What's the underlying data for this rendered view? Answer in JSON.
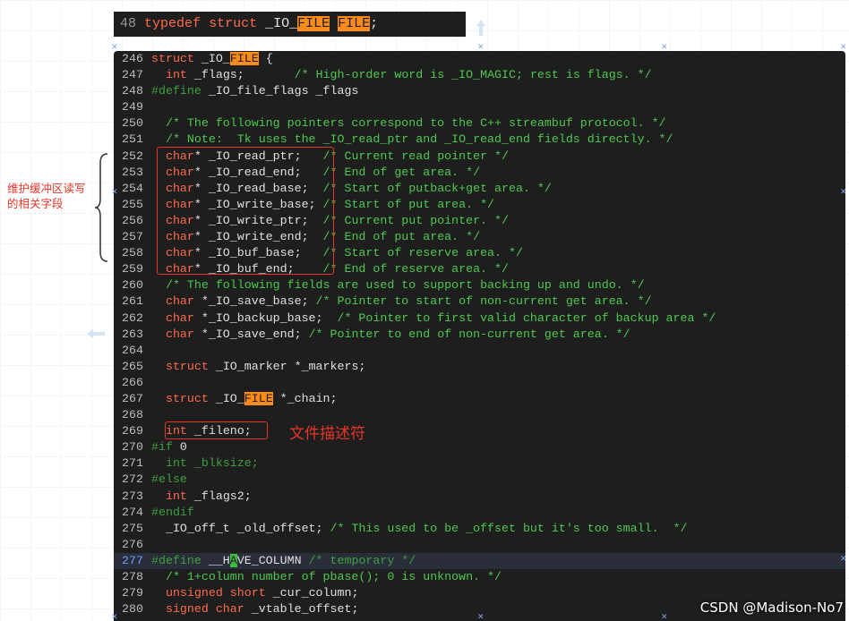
{
  "top_snippet": {
    "line_number": "48",
    "kw1": "typedef",
    "kw2": "struct",
    "name_a": "_IO_",
    "name_hl": "FILE",
    "sp": " ",
    "alias_hl": "FILE",
    "semi": ";"
  },
  "code_lines": [
    {
      "n": "246",
      "t": [
        {
          "c": "kw",
          "s": "struct"
        },
        {
          "c": "plain",
          "s": " _IO_"
        },
        {
          "c": "hl",
          "s": "FILE"
        },
        {
          "c": "plain",
          "s": " {"
        }
      ]
    },
    {
      "n": "247",
      "t": [
        {
          "c": "plain",
          "s": "  "
        },
        {
          "c": "kw",
          "s": "int"
        },
        {
          "c": "plain",
          "s": " _flags;"
        },
        {
          "c": "plain",
          "s": "       "
        },
        {
          "c": "cm",
          "s": "/* High-order word is _IO_MAGIC; rest is flags. */"
        }
      ]
    },
    {
      "n": "248",
      "t": [
        {
          "c": "cmd",
          "s": "#define"
        },
        {
          "c": "plain",
          "s": " _IO_file_flags _flags"
        }
      ]
    },
    {
      "n": "249",
      "t": []
    },
    {
      "n": "250",
      "t": [
        {
          "c": "plain",
          "s": "  "
        },
        {
          "c": "cm",
          "s": "/* The following pointers correspond to the C++ streambuf protocol. */"
        }
      ]
    },
    {
      "n": "251",
      "t": [
        {
          "c": "plain",
          "s": "  "
        },
        {
          "c": "cm",
          "s": "/* Note:  Tk uses the _IO_read_ptr and _IO_read_end fields directly. */"
        }
      ]
    },
    {
      "n": "252",
      "t": [
        {
          "c": "plain",
          "s": "  "
        },
        {
          "c": "kw",
          "s": "char"
        },
        {
          "c": "plain",
          "s": "* _IO_read_ptr;   "
        },
        {
          "c": "cm",
          "s": "/* Current read pointer */"
        }
      ]
    },
    {
      "n": "253",
      "t": [
        {
          "c": "plain",
          "s": "  "
        },
        {
          "c": "kw",
          "s": "char"
        },
        {
          "c": "plain",
          "s": "* _IO_read_end;   "
        },
        {
          "c": "cm",
          "s": "/* End of get area. */"
        }
      ]
    },
    {
      "n": "254",
      "t": [
        {
          "c": "plain",
          "s": "  "
        },
        {
          "c": "kw",
          "s": "char"
        },
        {
          "c": "plain",
          "s": "* _IO_read_base;  "
        },
        {
          "c": "cm",
          "s": "/* Start of putback+get area. */"
        }
      ]
    },
    {
      "n": "255",
      "t": [
        {
          "c": "plain",
          "s": "  "
        },
        {
          "c": "kw",
          "s": "char"
        },
        {
          "c": "plain",
          "s": "* _IO_write_base; "
        },
        {
          "c": "cm",
          "s": "/* Start of put area. */"
        }
      ]
    },
    {
      "n": "256",
      "t": [
        {
          "c": "plain",
          "s": "  "
        },
        {
          "c": "kw",
          "s": "char"
        },
        {
          "c": "plain",
          "s": "* _IO_write_ptr;  "
        },
        {
          "c": "cm",
          "s": "/* Current put pointer. */"
        }
      ]
    },
    {
      "n": "257",
      "t": [
        {
          "c": "plain",
          "s": "  "
        },
        {
          "c": "kw",
          "s": "char"
        },
        {
          "c": "plain",
          "s": "* _IO_write_end;  "
        },
        {
          "c": "cm",
          "s": "/* End of put area. */"
        }
      ]
    },
    {
      "n": "258",
      "t": [
        {
          "c": "plain",
          "s": "  "
        },
        {
          "c": "kw",
          "s": "char"
        },
        {
          "c": "plain",
          "s": "* _IO_buf_base;   "
        },
        {
          "c": "cm",
          "s": "/* Start of reserve area. */"
        }
      ]
    },
    {
      "n": "259",
      "t": [
        {
          "c": "plain",
          "s": "  "
        },
        {
          "c": "kw",
          "s": "char"
        },
        {
          "c": "plain",
          "s": "* _IO_buf_end;    "
        },
        {
          "c": "cm",
          "s": "/* End of reserve area. */"
        }
      ]
    },
    {
      "n": "260",
      "t": [
        {
          "c": "plain",
          "s": "  "
        },
        {
          "c": "cm",
          "s": "/* The following fields are used to support backing up and undo. */"
        }
      ]
    },
    {
      "n": "261",
      "t": [
        {
          "c": "plain",
          "s": "  "
        },
        {
          "c": "kw",
          "s": "char"
        },
        {
          "c": "plain",
          "s": " *_IO_save_base; "
        },
        {
          "c": "cm",
          "s": "/* Pointer to start of non-current get area. */"
        }
      ]
    },
    {
      "n": "262",
      "t": [
        {
          "c": "plain",
          "s": "  "
        },
        {
          "c": "kw",
          "s": "char"
        },
        {
          "c": "plain",
          "s": " *_IO_backup_base;  "
        },
        {
          "c": "cm",
          "s": "/* Pointer to first valid character of backup area */"
        }
      ]
    },
    {
      "n": "263",
      "t": [
        {
          "c": "plain",
          "s": "  "
        },
        {
          "c": "kw",
          "s": "char"
        },
        {
          "c": "plain",
          "s": " *_IO_save_end; "
        },
        {
          "c": "cm",
          "s": "/* Pointer to end of non-current get area. */"
        }
      ]
    },
    {
      "n": "264",
      "t": []
    },
    {
      "n": "265",
      "t": [
        {
          "c": "plain",
          "s": "  "
        },
        {
          "c": "kw",
          "s": "struct"
        },
        {
          "c": "plain",
          "s": " _IO_marker *_markers;"
        }
      ]
    },
    {
      "n": "266",
      "t": []
    },
    {
      "n": "267",
      "t": [
        {
          "c": "plain",
          "s": "  "
        },
        {
          "c": "kw",
          "s": "struct"
        },
        {
          "c": "plain",
          "s": " _IO_"
        },
        {
          "c": "hl",
          "s": "FILE"
        },
        {
          "c": "plain",
          "s": " *_chain;"
        }
      ]
    },
    {
      "n": "268",
      "t": []
    },
    {
      "n": "269",
      "t": [
        {
          "c": "plain",
          "s": "  "
        },
        {
          "c": "kw",
          "s": "int"
        },
        {
          "c": "plain",
          "s": " _fileno;"
        }
      ]
    },
    {
      "n": "270",
      "t": [
        {
          "c": "cmd",
          "s": "#if"
        },
        {
          "c": "plain",
          "s": " 0"
        }
      ]
    },
    {
      "n": "271",
      "t": [
        {
          "c": "plain",
          "s": "  "
        },
        {
          "c": "cmd",
          "s": "int _blksize;"
        }
      ]
    },
    {
      "n": "272",
      "t": [
        {
          "c": "cmd",
          "s": "#else"
        }
      ]
    },
    {
      "n": "273",
      "t": [
        {
          "c": "plain",
          "s": "  "
        },
        {
          "c": "kw",
          "s": "int"
        },
        {
          "c": "plain",
          "s": " _flags2;"
        }
      ]
    },
    {
      "n": "274",
      "t": [
        {
          "c": "cmd",
          "s": "#endif"
        }
      ]
    },
    {
      "n": "275",
      "t": [
        {
          "c": "plain",
          "s": "  _IO_off_t _old_offset; "
        },
        {
          "c": "cm",
          "s": "/* This used to be _offset but it's too small.  */"
        }
      ]
    },
    {
      "n": "276",
      "t": []
    },
    {
      "n": "277",
      "t": [
        {
          "c": "cmd",
          "s": "#define"
        },
        {
          "c": "plain",
          "s": " __H"
        },
        {
          "c": "hlg",
          "s": "A"
        },
        {
          "c": "plain",
          "s": "VE_COLUMN "
        },
        {
          "c": "cmd",
          "s": "/* temporary */"
        }
      ],
      "current": true
    },
    {
      "n": "278",
      "t": [
        {
          "c": "plain",
          "s": "  "
        },
        {
          "c": "cm",
          "s": "/* 1+column number of pbase(); 0 is unknown. */"
        }
      ]
    },
    {
      "n": "279",
      "t": [
        {
          "c": "plain",
          "s": "  "
        },
        {
          "c": "kw",
          "s": "unsigned short"
        },
        {
          "c": "plain",
          "s": " _cur_column;"
        }
      ]
    },
    {
      "n": "280",
      "t": [
        {
          "c": "plain",
          "s": "  "
        },
        {
          "c": "kw",
          "s": "signed char"
        },
        {
          "c": "plain",
          "s": " _vtable_offset;"
        }
      ]
    }
  ],
  "annotations": {
    "buffer_fields_label": "维护缓冲区读写的相关字段",
    "fileno_label": "文件描述符"
  },
  "watermark": "CSDN @Madison-No7",
  "colors": {
    "keyword": "#ff6b4a",
    "highlight": "#ff8c1a",
    "comment": "#4ec94e",
    "annotation": "#e8352a",
    "background": "#1e1e1e"
  }
}
